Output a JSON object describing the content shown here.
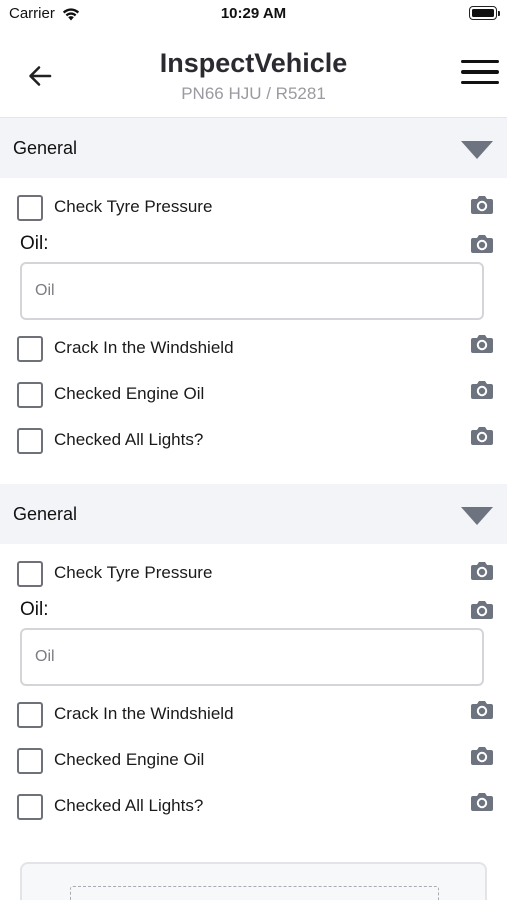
{
  "status_bar": {
    "carrier": "Carrier",
    "time": "10:29 AM"
  },
  "header": {
    "title": "InspectVehicle",
    "subtitle": "PN66 HJU / R5281"
  },
  "sections": [
    {
      "title": "General",
      "items": [
        {
          "label": "Check Tyre Pressure"
        },
        {
          "label": "Crack In the Windshield"
        },
        {
          "label": "Checked Engine Oil"
        },
        {
          "label": "Checked All Lights?"
        }
      ],
      "oil": {
        "label": "Oil:",
        "placeholder": "Oil",
        "value": ""
      }
    },
    {
      "title": "General",
      "items": [
        {
          "label": "Check Tyre Pressure"
        },
        {
          "label": "Crack In the Windshield"
        },
        {
          "label": "Checked Engine Oil"
        },
        {
          "label": "Checked All Lights?"
        }
      ],
      "oil": {
        "label": "Oil:",
        "placeholder": "Oil",
        "value": ""
      }
    }
  ],
  "icons": {
    "back": "arrow-left-icon",
    "menu": "hamburger-menu-icon",
    "collapse": "caret-down-icon",
    "photo": "camera-icon",
    "wifi": "wifi-icon",
    "battery": "battery-icon"
  },
  "colors": {
    "section_header_bg": "#f3f4f8",
    "camera_icon": "#6e7380",
    "title_text": "#2a2a30",
    "subtitle_text": "#9a9aa0"
  }
}
